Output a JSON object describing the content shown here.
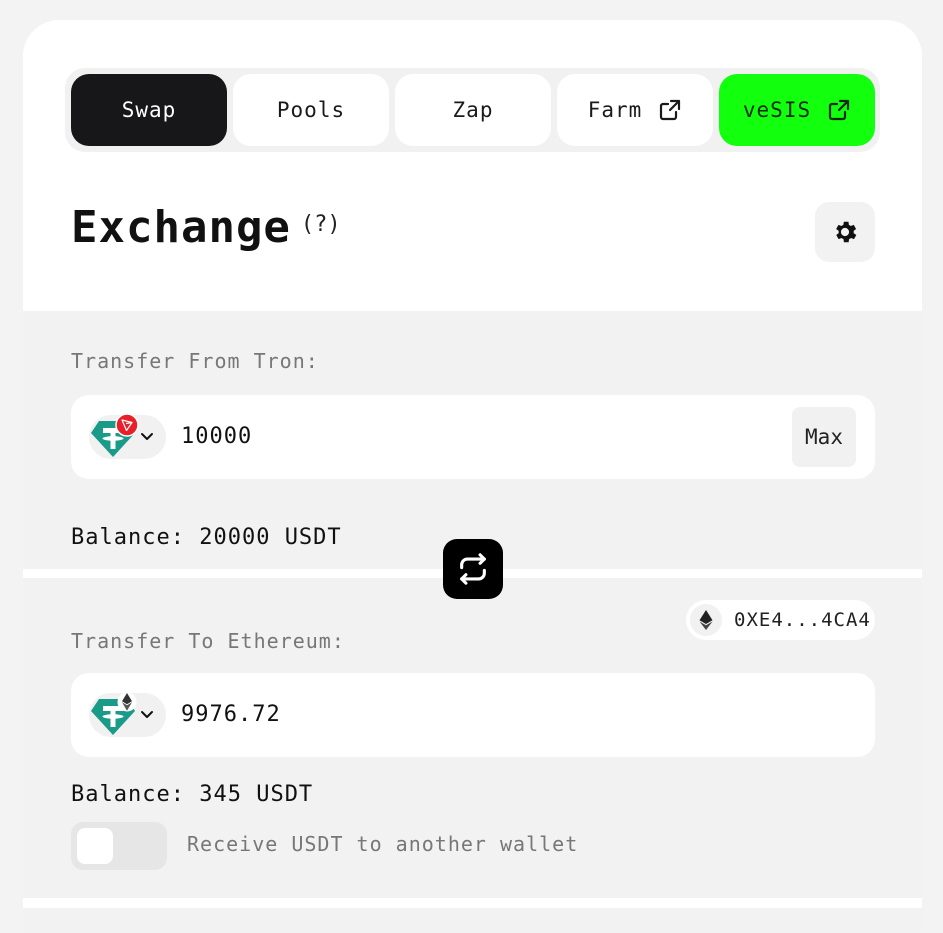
{
  "tabs": [
    {
      "label": "Swap",
      "active": true,
      "external": false
    },
    {
      "label": "Pools",
      "active": false,
      "external": false
    },
    {
      "label": "Zap",
      "active": false,
      "external": false
    },
    {
      "label": "Farm",
      "active": false,
      "external": true,
      "icon": "external-link-icon"
    },
    {
      "label": "veSIS",
      "active": false,
      "external": true,
      "icon": "external-link-icon",
      "color": "#12ff0e"
    }
  ],
  "header": {
    "title": "Exchange",
    "help": "(?)",
    "settings_icon": "gear-icon"
  },
  "from": {
    "label": "Transfer From Tron:",
    "amount": "10000",
    "max_label": "Max",
    "balance_label": "Balance:",
    "balance_value": "20000 USDT",
    "token_icon": "usdt-icon",
    "chain_icon": "tron-icon"
  },
  "to": {
    "label": "Transfer To Ethereum:",
    "address": "0XE4...4CA4",
    "amount": "9976.72",
    "balance_label": "Balance:",
    "balance_value": "345 USDT",
    "token_icon": "usdt-icon",
    "chain_icon": "ethereum-icon"
  },
  "receive_toggle": {
    "label": "Receive USDT to another wallet",
    "on": false
  },
  "colors": {
    "accent": "#12ff0e",
    "usdt": "#1a9b8a",
    "tron": "#e8202a",
    "dark": "#17171a"
  }
}
